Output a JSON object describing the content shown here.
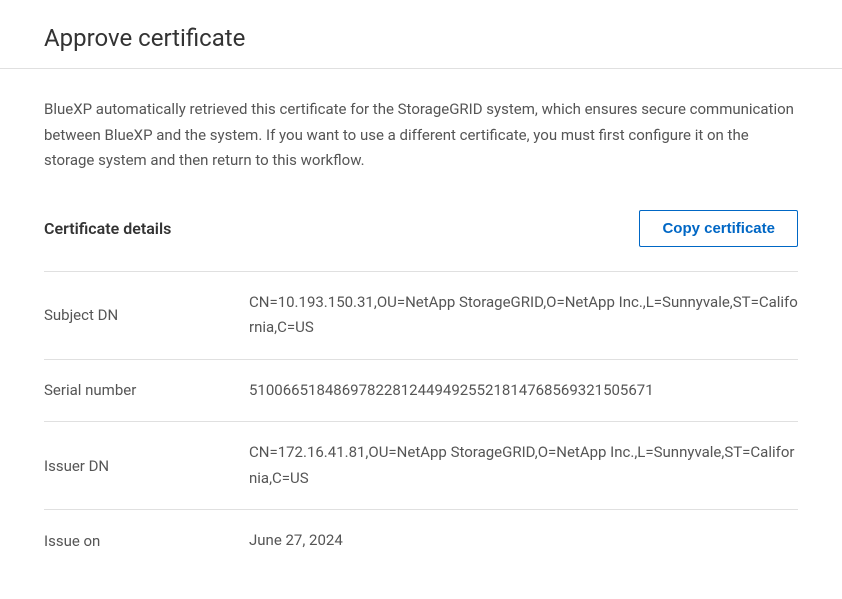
{
  "header": {
    "title": "Approve certificate"
  },
  "description": "BlueXP automatically retrieved this certificate for the StorageGRID system, which ensures secure communication between BlueXP and the system. If you want to use a different certificate, you must first configure it on the storage system and then return to this workflow.",
  "details": {
    "title": "Certificate details",
    "copy_button": "Copy certificate",
    "rows": [
      {
        "label": "Subject DN",
        "value": "CN=10.193.150.31,OU=NetApp StorageGRID,O=NetApp Inc.,L=Sunnyvale,ST=California,C=US"
      },
      {
        "label": "Serial number",
        "value": "510066518486978228124494925521814768569321505671"
      },
      {
        "label": "Issuer DN",
        "value": "CN=172.16.41.81,OU=NetApp StorageGRID,O=NetApp Inc.,L=Sunnyvale,ST=California,C=US"
      },
      {
        "label": "Issue on",
        "value": "June 27, 2024"
      }
    ]
  }
}
